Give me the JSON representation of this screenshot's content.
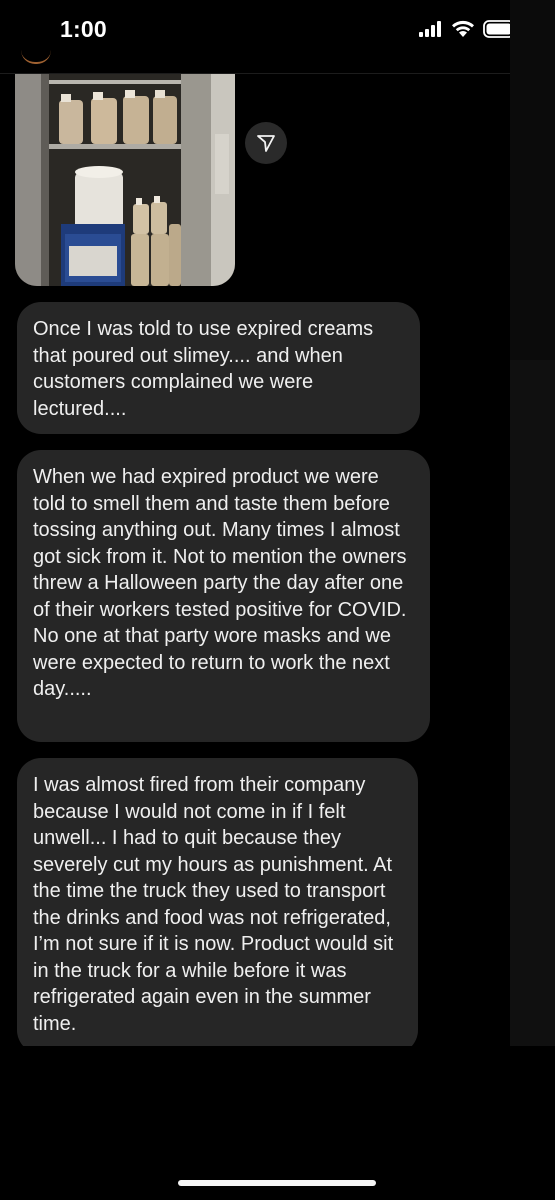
{
  "status_bar": {
    "time": "1:00",
    "icons": [
      "signal-icon",
      "wifi-icon",
      "battery-icon"
    ]
  },
  "photo_message": {
    "description_icon": "refrigerator-photo"
  },
  "share_button": {
    "icon": "send-arrow-icon"
  },
  "messages": [
    {
      "text": "Once I was told to use expired creams that poured out slimey.... and when customers complained we were lectured...."
    },
    {
      "text": "When we had expired product we were told to smell them and taste them before tossing anything out. Many times I almost got sick from it. Not to mention the owners threw a Halloween party the day after one of their workers tested positive for COVID. No one at that party wore masks and we were expected to return to work the next day....."
    },
    {
      "text": "I was almost fired from their company because I would not come in if I felt unwell... I had to quit because they severely cut my hours as punishment. At the time the truck they used to transport the drinks and food was not refrigerated, I’m not sure if it is now. Product would sit in the truck for a while before it was refrigerated again even in the summer time."
    }
  ],
  "colors": {
    "background": "#000000",
    "bubble": "#262626",
    "text": "#efefef"
  }
}
